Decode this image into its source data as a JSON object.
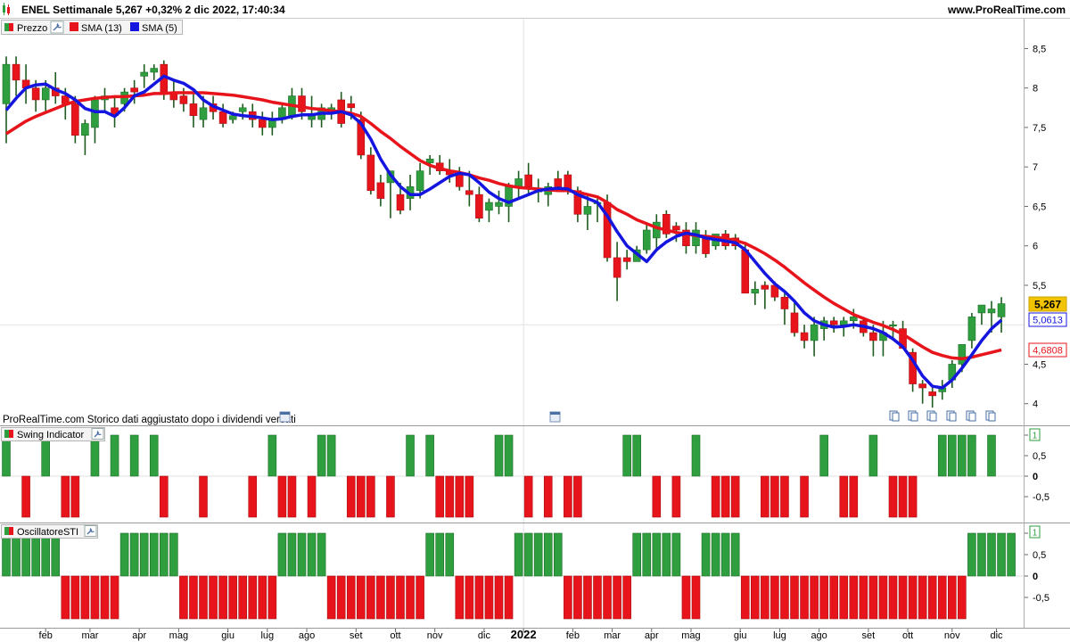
{
  "header": {
    "title": "ENEL Settimanale 5,267 +0,32% 2 dic 2022, 17:40:34",
    "brand": "www.ProRealTime.com"
  },
  "price_panel": {
    "legend": [
      {
        "label": "Prezzo",
        "color": "#2e9e3e"
      },
      {
        "label": "SMA (13)",
        "color": "#e8141b"
      },
      {
        "label": "SMA (5)",
        "color": "#1515e0"
      }
    ],
    "note": "ProRealTime.com Storico dati aggiustato dopo i dividendi versati",
    "badges": {
      "last": "5,267",
      "sma5": "5,0613",
      "sma13": "4,6808"
    }
  },
  "swing_panel": {
    "title": "Swing Indicator",
    "badge": "1"
  },
  "osc_panel": {
    "title": "OscillatoreSTI",
    "badge": "1"
  },
  "colors": {
    "up": "#2e9e3e",
    "down": "#e8141b",
    "sma13": "#e8141b",
    "sma5": "#1515e0",
    "last_badge": "#f2c300"
  },
  "icons": [
    "wrench-icon",
    "calendar-icon",
    "document-icon"
  ],
  "chart_data": [
    {
      "type": "candlestick",
      "title": "ENEL Settimanale",
      "ylim": [
        3.8,
        8.8
      ],
      "y_ticks": [
        "8,5",
        "8",
        "7,5",
        "7",
        "6,5",
        "6",
        "5,5",
        "4,5",
        "4"
      ],
      "y_tick_values": [
        8.5,
        8,
        7.5,
        7,
        6.5,
        6,
        5.5,
        4.5,
        4
      ],
      "x_ticks": [
        "feb",
        "mar",
        "apr",
        "mag",
        "giu",
        "lug",
        "ago",
        "set",
        "ott",
        "nov",
        "dic",
        "2022",
        "feb",
        "mar",
        "apr",
        "mag",
        "giu",
        "lug",
        "ago",
        "set",
        "ott",
        "nov",
        "dic"
      ],
      "x_tick_index": [
        4,
        8.5,
        13.5,
        17.5,
        22.5,
        26.5,
        30.5,
        35.5,
        39.5,
        43.5,
        48.5,
        52.5,
        57.5,
        61.5,
        65.5,
        69.5,
        74.5,
        78.5,
        82.5,
        87.5,
        91.5,
        96,
        100.5
      ],
      "ohlc": [
        [
          7.8,
          8.4,
          7.3,
          8.3
        ],
        [
          8.3,
          8.4,
          7.9,
          8.1
        ],
        [
          8.1,
          8.3,
          7.8,
          8.0
        ],
        [
          8.0,
          8.1,
          7.7,
          7.85
        ],
        [
          7.85,
          8.1,
          7.7,
          8.0
        ],
        [
          8.0,
          8.2,
          7.8,
          7.9
        ],
        [
          7.9,
          8.0,
          7.6,
          7.8
        ],
        [
          7.8,
          7.9,
          7.3,
          7.4
        ],
        [
          7.4,
          7.6,
          7.15,
          7.55
        ],
        [
          7.5,
          7.9,
          7.3,
          7.85
        ],
        [
          7.85,
          8.0,
          7.7,
          7.9
        ],
        [
          7.75,
          7.9,
          7.5,
          7.65
        ],
        [
          7.8,
          8.0,
          7.7,
          7.95
        ],
        [
          8.0,
          8.1,
          7.8,
          7.95
        ],
        [
          8.15,
          8.3,
          8.0,
          8.2
        ],
        [
          8.2,
          8.3,
          8.1,
          8.25
        ],
        [
          8.3,
          8.35,
          7.85,
          7.95
        ],
        [
          7.95,
          8.1,
          7.75,
          7.85
        ],
        [
          7.9,
          8.0,
          7.7,
          7.8
        ],
        [
          7.8,
          7.95,
          7.5,
          7.65
        ],
        [
          7.6,
          7.9,
          7.5,
          7.75
        ],
        [
          7.8,
          7.9,
          7.6,
          7.7
        ],
        [
          7.7,
          7.8,
          7.5,
          7.55
        ],
        [
          7.6,
          7.7,
          7.55,
          7.65
        ],
        [
          7.7,
          7.8,
          7.6,
          7.75
        ],
        [
          7.7,
          7.8,
          7.5,
          7.6
        ],
        [
          7.6,
          7.7,
          7.4,
          7.5
        ],
        [
          7.5,
          7.7,
          7.4,
          7.6
        ],
        [
          7.6,
          7.8,
          7.55,
          7.75
        ],
        [
          7.65,
          8.0,
          7.6,
          7.9
        ],
        [
          7.9,
          8.0,
          7.6,
          7.7
        ],
        [
          7.6,
          7.9,
          7.5,
          7.65
        ],
        [
          7.6,
          7.8,
          7.5,
          7.75
        ],
        [
          7.7,
          7.8,
          7.6,
          7.75
        ],
        [
          7.85,
          7.95,
          7.5,
          7.55
        ],
        [
          7.8,
          7.9,
          7.6,
          7.75
        ],
        [
          7.6,
          7.7,
          7.1,
          7.15
        ],
        [
          7.15,
          7.25,
          6.65,
          6.7
        ],
        [
          6.8,
          6.9,
          6.5,
          6.6
        ],
        [
          6.8,
          6.9,
          6.35,
          6.95
        ],
        [
          6.65,
          6.8,
          6.4,
          6.45
        ],
        [
          6.6,
          6.9,
          6.45,
          6.75
        ],
        [
          6.7,
          7.05,
          6.6,
          6.95
        ],
        [
          7.05,
          7.15,
          6.9,
          7.1
        ],
        [
          7.05,
          7.15,
          6.9,
          6.95
        ],
        [
          6.95,
          7.1,
          6.8,
          6.9
        ],
        [
          6.9,
          7.0,
          6.7,
          6.75
        ],
        [
          6.7,
          6.95,
          6.5,
          6.65
        ],
        [
          6.65,
          6.75,
          6.3,
          6.35
        ],
        [
          6.45,
          6.6,
          6.3,
          6.55
        ],
        [
          6.5,
          6.7,
          6.4,
          6.55
        ],
        [
          6.5,
          6.8,
          6.3,
          6.75
        ],
        [
          6.75,
          6.95,
          6.6,
          6.85
        ],
        [
          6.9,
          7.05,
          6.65,
          6.75
        ],
        [
          6.7,
          6.85,
          6.55,
          6.7
        ],
        [
          6.65,
          6.8,
          6.5,
          6.75
        ],
        [
          6.85,
          6.95,
          6.7,
          6.75
        ],
        [
          6.9,
          6.95,
          6.65,
          6.7
        ],
        [
          6.7,
          6.75,
          6.3,
          6.4
        ],
        [
          6.4,
          6.65,
          6.2,
          6.5
        ],
        [
          6.55,
          6.6,
          6.3,
          6.55
        ],
        [
          6.55,
          6.65,
          5.8,
          5.85
        ],
        [
          5.85,
          6.05,
          5.3,
          5.6
        ],
        [
          5.85,
          5.95,
          5.7,
          5.8
        ],
        [
          5.8,
          6.0,
          5.8,
          5.95
        ],
        [
          5.95,
          6.3,
          5.9,
          6.2
        ],
        [
          6.1,
          6.4,
          5.95,
          6.3
        ],
        [
          6.4,
          6.45,
          6.1,
          6.15
        ],
        [
          6.25,
          6.3,
          6.05,
          6.2
        ],
        [
          6.2,
          6.3,
          5.9,
          6.0
        ],
        [
          6.0,
          6.3,
          5.9,
          6.2
        ],
        [
          6.1,
          6.2,
          5.85,
          5.9
        ],
        [
          6.0,
          6.15,
          5.95,
          6.15
        ],
        [
          6.15,
          6.2,
          5.95,
          6.0
        ],
        [
          6.1,
          6.15,
          5.95,
          6.0
        ],
        [
          5.95,
          6.05,
          5.4,
          5.4
        ],
        [
          5.4,
          5.55,
          5.25,
          5.45
        ],
        [
          5.5,
          5.55,
          5.2,
          5.45
        ],
        [
          5.5,
          5.55,
          5.3,
          5.35
        ],
        [
          5.35,
          5.4,
          5.0,
          5.2
        ],
        [
          5.15,
          5.3,
          4.85,
          4.9
        ],
        [
          4.9,
          5.0,
          4.7,
          4.8
        ],
        [
          4.8,
          5.1,
          4.6,
          5.0
        ],
        [
          4.95,
          5.1,
          4.8,
          5.05
        ],
        [
          5.05,
          5.1,
          4.9,
          5.0
        ],
        [
          5.0,
          5.1,
          4.85,
          5.05
        ],
        [
          5.05,
          5.2,
          4.95,
          5.1
        ],
        [
          5.05,
          5.1,
          4.85,
          4.9
        ],
        [
          4.9,
          5.0,
          4.6,
          4.8
        ],
        [
          4.8,
          5.05,
          4.6,
          4.9
        ],
        [
          5.0,
          5.05,
          4.8,
          5.0
        ],
        [
          4.95,
          5.05,
          4.7,
          4.7
        ],
        [
          4.65,
          4.7,
          4.15,
          4.25
        ],
        [
          4.25,
          4.3,
          4.0,
          4.2
        ],
        [
          4.15,
          4.2,
          3.95,
          4.1
        ],
        [
          4.15,
          4.3,
          4.05,
          4.2
        ],
        [
          4.3,
          4.55,
          4.2,
          4.5
        ],
        [
          4.5,
          4.7,
          4.4,
          4.75
        ],
        [
          4.8,
          5.15,
          4.7,
          5.1
        ],
        [
          5.15,
          5.25,
          5.0,
          5.25
        ],
        [
          5.15,
          5.3,
          4.9,
          5.2
        ],
        [
          5.1,
          5.35,
          4.9,
          5.267
        ]
      ],
      "sma5": [
        7.72,
        7.87,
        8.0,
        8.04,
        8.05,
        7.98,
        7.93,
        7.85,
        7.74,
        7.7,
        7.7,
        7.64,
        7.75,
        7.9,
        7.95,
        8.05,
        8.15,
        8.1,
        8.06,
        7.98,
        7.85,
        7.77,
        7.72,
        7.67,
        7.65,
        7.64,
        7.62,
        7.6,
        7.61,
        7.64,
        7.66,
        7.66,
        7.68,
        7.68,
        7.7,
        7.66,
        7.55,
        7.35,
        7.1,
        6.9,
        6.75,
        6.65,
        6.65,
        6.72,
        6.8,
        6.88,
        6.92,
        6.9,
        6.8,
        6.68,
        6.6,
        6.55,
        6.6,
        6.65,
        6.7,
        6.72,
        6.73,
        6.72,
        6.65,
        6.6,
        6.55,
        6.38,
        6.18,
        6.0,
        5.9,
        5.8,
        5.95,
        6.05,
        6.12,
        6.16,
        6.14,
        6.1,
        6.08,
        6.06,
        6.04,
        5.95,
        5.8,
        5.65,
        5.52,
        5.42,
        5.3,
        5.15,
        5.05,
        5.0,
        4.97,
        4.98,
        5.0,
        4.98,
        4.95,
        4.9,
        4.82,
        4.72,
        4.55,
        4.35,
        4.22,
        4.2,
        4.3,
        4.45,
        4.62,
        4.8,
        4.95,
        5.06
      ],
      "sma13": [
        7.42,
        7.5,
        7.58,
        7.64,
        7.69,
        7.74,
        7.79,
        7.83,
        7.85,
        7.87,
        7.88,
        7.89,
        7.89,
        7.9,
        7.91,
        7.93,
        7.93,
        7.94,
        7.94,
        7.94,
        7.94,
        7.93,
        7.92,
        7.91,
        7.89,
        7.87,
        7.85,
        7.82,
        7.8,
        7.78,
        7.76,
        7.74,
        7.73,
        7.71,
        7.7,
        7.68,
        7.64,
        7.55,
        7.45,
        7.36,
        7.26,
        7.17,
        7.08,
        7.02,
        6.98,
        6.95,
        6.93,
        6.9,
        6.86,
        6.83,
        6.79,
        6.76,
        6.74,
        6.73,
        6.72,
        6.71,
        6.7,
        6.7,
        6.68,
        6.65,
        6.62,
        6.55,
        6.46,
        6.4,
        6.33,
        6.28,
        6.23,
        6.2,
        6.17,
        6.15,
        6.13,
        6.12,
        6.11,
        6.09,
        6.07,
        6.03,
        5.97,
        5.9,
        5.82,
        5.73,
        5.63,
        5.53,
        5.44,
        5.35,
        5.27,
        5.2,
        5.13,
        5.08,
        5.03,
        4.99,
        4.94,
        4.88,
        4.8,
        4.72,
        4.65,
        4.61,
        4.58,
        4.57,
        4.59,
        4.62,
        4.65,
        4.6808
      ]
    },
    {
      "type": "bar",
      "title": "Swing Indicator",
      "ylim": [
        -1,
        1
      ],
      "y_ticks": [
        "1",
        "0,5",
        "0",
        "-0,5"
      ],
      "y_tick_values": [
        1,
        0.5,
        0,
        -0.5
      ],
      "values": [
        1,
        0,
        -1,
        0,
        1,
        0,
        -1,
        -1,
        0,
        1,
        0,
        1,
        0,
        1,
        0,
        1,
        -1,
        0,
        0,
        0,
        -1,
        0,
        0,
        0,
        0,
        -1,
        0,
        1,
        -1,
        -1,
        0,
        -1,
        1,
        1,
        0,
        -1,
        -1,
        -1,
        0,
        -1,
        0,
        1,
        0,
        1,
        -1,
        -1,
        -1,
        -1,
        0,
        0,
        1,
        1,
        0,
        -1,
        0,
        -1,
        0,
        -1,
        -1,
        0,
        0,
        0,
        0,
        1,
        1,
        0,
        -1,
        0,
        -1,
        0,
        1,
        0,
        -1,
        -1,
        -1,
        0,
        0,
        -1,
        -1,
        -1,
        0,
        -1,
        0,
        1,
        0,
        -1,
        -1,
        0,
        1,
        0,
        -1,
        -1,
        -1,
        0,
        0,
        1,
        1,
        1,
        1,
        0,
        1,
        0
      ]
    },
    {
      "type": "bar",
      "title": "OscillatoreSTI",
      "ylim": [
        -1,
        1
      ],
      "y_ticks": [
        "1",
        "0,5",
        "0",
        "-0,5"
      ],
      "y_tick_values": [
        1,
        0.5,
        0,
        -0.5
      ],
      "values": [
        1,
        1,
        1,
        1,
        1,
        1,
        -1,
        -1,
        -1,
        -1,
        -1,
        -1,
        1,
        1,
        1,
        1,
        1,
        1,
        -1,
        -1,
        -1,
        -1,
        -1,
        -1,
        -1,
        -1,
        -1,
        -1,
        1,
        1,
        1,
        1,
        1,
        -1,
        -1,
        -1,
        -1,
        -1,
        -1,
        -1,
        -1,
        -1,
        -1,
        1,
        1,
        1,
        -1,
        -1,
        -1,
        -1,
        -1,
        -1,
        1,
        1,
        1,
        1,
        1,
        -1,
        -1,
        -1,
        -1,
        -1,
        -1,
        -1,
        1,
        1,
        1,
        1,
        1,
        -1,
        -1,
        1,
        1,
        1,
        1,
        -1,
        -1,
        -1,
        -1,
        -1,
        -1,
        -1,
        -1,
        -1,
        -1,
        -1,
        -1,
        -1,
        -1,
        -1,
        -1,
        -1,
        -1,
        -1,
        -1,
        -1,
        -1,
        -1,
        1,
        1,
        1,
        1,
        1,
        0,
        0
      ]
    }
  ]
}
